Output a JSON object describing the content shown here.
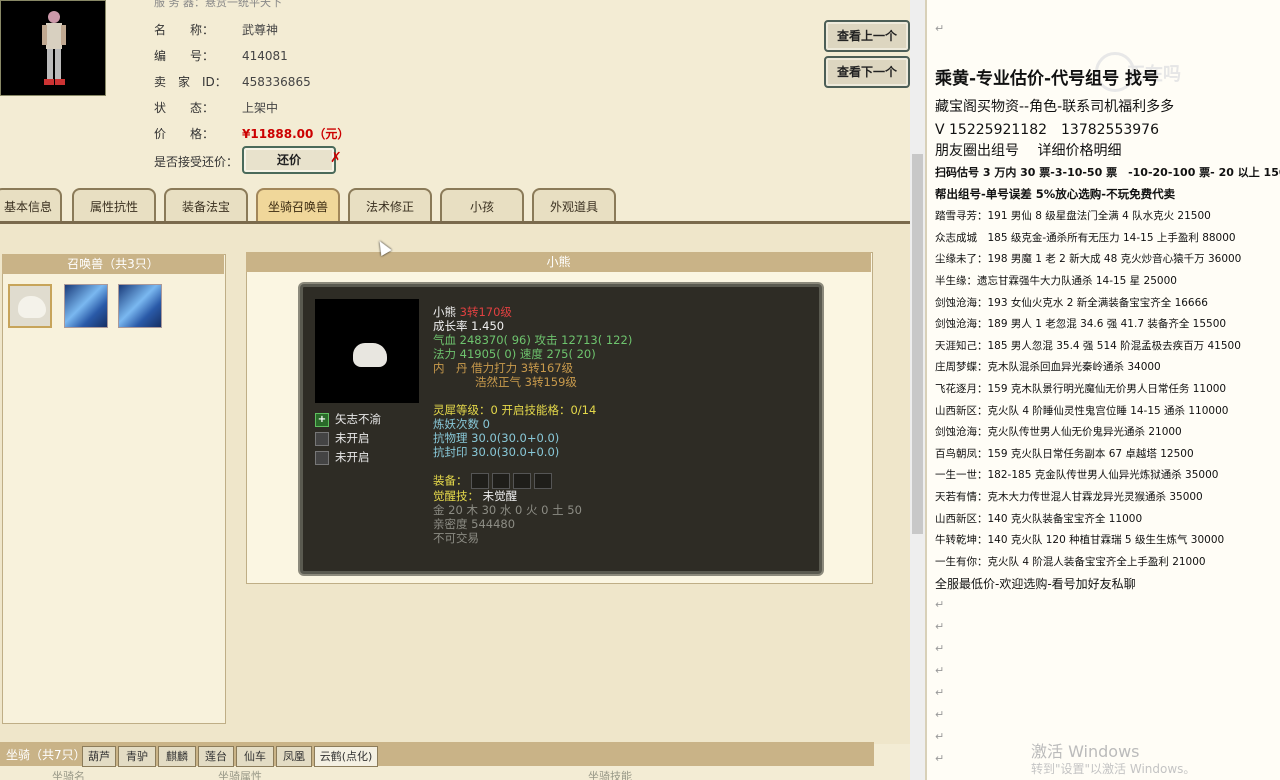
{
  "top_partial": "服 务 器：悬赏一统平天下",
  "info": {
    "name_label": "名　　称：",
    "name": "武尊神",
    "id_label": "编　　号：",
    "id": "414081",
    "seller_label": "卖　家　ID：",
    "seller": "458336865",
    "state_label": "状　　态：",
    "state": "上架中",
    "price_label": "价　　格：",
    "price": "¥11888.00（元）",
    "offer_label": "是否接受还价：",
    "offer_button": "还价",
    "x_mark": "✗"
  },
  "nav": {
    "prev": "查看上一个",
    "next": "查看下一个"
  },
  "tabs": [
    "基本信息",
    "属性抗性",
    "装备法宝",
    "坐骑召唤兽",
    "法术修正",
    "小孩",
    "外观道具"
  ],
  "summon_panel_title": "召唤兽（共3只）",
  "detail_panel_title": "小熊",
  "pet": {
    "name": "小熊",
    "turn": "3转170级",
    "growth": "成长率 1.450",
    "hp_label": "气血 ",
    "hp": "248370( 96)",
    "atk_label": " 攻击 ",
    "atk": "12713( 122)",
    "mp_label": "法力 ",
    "mp": "41905( 0)",
    "spd_label": " 速度 ",
    "spd": "275( 20)",
    "neidan_label": "内　丹 ",
    "neidan1": "借力打力 3转167级",
    "neidan2": "浩然正气 3转159级",
    "lingxi": "灵犀等级：0 开启技能格：0/14",
    "lianyao": "炼妖次数 0",
    "kwl": "抗物理 30.0(30.0+0.0)",
    "kfy": "抗封印 30.0(30.0+0.0)",
    "equip_label": "装备：",
    "awake_label": "觉醒技：",
    "awake_value": "未觉醒",
    "elements": "金 20 木 30 水 0 火 0 土 50",
    "intimacy": "亲密度 544480",
    "trade": "不可交易",
    "skills": [
      "矢志不渝",
      "未开启",
      "未开启"
    ]
  },
  "mount": {
    "title": "坐骑（共7只）",
    "tabs": [
      "葫芦",
      "青驴",
      "麒麟",
      "莲台",
      "仙车",
      "凤凰",
      "云鹤(点化)"
    ],
    "col1": "坐骑名",
    "col2": "坐骑属性",
    "col3": "坐骑技能"
  },
  "right": {
    "logo": "正在吗",
    "headline": "乘黄-专业估价-代号组号 找号",
    "line2": "藏宝阁买物资--角色-联系司机福利多多",
    "line3": "V 15225921182　13782553976",
    "line4": "朋友圈出组号　 详细价格明细",
    "line5": "扫码估号 3 万内 30 票-3-10-50 票　-10-20-100 票- 20 以上 150",
    "line6": "帮出组号-单号误差 5%放心选购-不玩免费代卖",
    "listings": [
      "踏雪寻芳：191 男仙 8 级星盘法门全满 4 队水克火 21500",
      "众志成城　185 级克金-通杀所有无压力 14-15 上手盈利 88000",
      "尘缘未了：198 男魔 1 老 2 新大成 48 克火炒音心猿千万 36000",
      "半生缘：遗忘甘霖强牛大力队通杀 14-15 星 25000",
      "剑蚀沧海：193 女仙火克水 2 新全满装备宝宝齐全 16666",
      "剑蚀沧海：189 男人 1 老忽混 34.6 强 41.7 装备齐全 15500",
      "天涯知己：185 男人忽混 35.4 强 514 阶混孟极去疾百万 41500",
      "庄周梦蝶：克木队混杀回血异光秦岭通杀 34000",
      "飞花逐月：159 克木队景行明光魔仙无价男人日常任务 11000",
      "山西新区：克火队 4 阶睡仙灵性鬼宫位睡 14-15 通杀 110000",
      "剑蚀沧海：克火队传世男人仙无价鬼异光通杀 21000",
      "百鸟朝凤：159 克火队日常任务副本 67 卓越塔 12500",
      "一生一世：182-185 克金队传世男人仙异光炼狱通杀 35000",
      "天若有情：克木大力传世混人甘霖龙异光灵猴通杀 35000",
      "山西新区：140 克火队装备宝宝齐全 11000",
      "牛转乾坤：140 克火队 120 种植甘霖瑞 5 级生生炼气 30000",
      "一生有你：克火队 4 阶混人装备宝宝齐全上手盈利 21000"
    ],
    "footer_line": "全服最低价-欢迎选购-看号加好友私聊",
    "watermark1": "激活 Windows",
    "watermark2": "转到\"设置\"以激活 Windows。"
  }
}
